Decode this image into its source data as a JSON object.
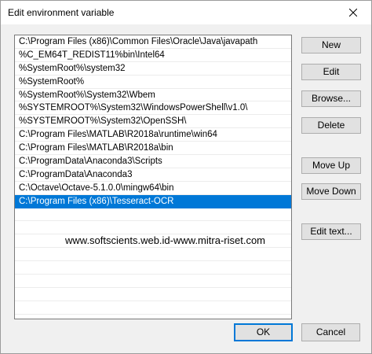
{
  "window": {
    "title": "Edit environment variable"
  },
  "list": {
    "items": [
      "C:\\Program Files (x86)\\Common Files\\Oracle\\Java\\javapath",
      "%C_EM64T_REDIST11%bin\\Intel64",
      "%SystemRoot%\\system32",
      "%SystemRoot%",
      "%SystemRoot%\\System32\\Wbem",
      "%SYSTEMROOT%\\System32\\WindowsPowerShell\\v1.0\\",
      "%SYSTEMROOT%\\System32\\OpenSSH\\",
      "C:\\Program Files\\MATLAB\\R2018a\\runtime\\win64",
      "C:\\Program Files\\MATLAB\\R2018a\\bin",
      "C:\\ProgramData\\Anaconda3\\Scripts",
      "C:\\ProgramData\\Anaconda3",
      "C:\\Octave\\Octave-5.1.0.0\\mingw64\\bin",
      "C:\\Program Files (x86)\\Tesseract-OCR"
    ],
    "selected_index": 12,
    "empty_rows": 8
  },
  "watermark": "www.softscients.web.id-www.mitra-riset.com",
  "buttons": {
    "new": "New",
    "edit": "Edit",
    "browse": "Browse...",
    "delete": "Delete",
    "move_up": "Move Up",
    "move_down": "Move Down",
    "edit_text": "Edit text..."
  },
  "footer": {
    "ok": "OK",
    "cancel": "Cancel"
  },
  "colors": {
    "selection": "#0078d7"
  }
}
